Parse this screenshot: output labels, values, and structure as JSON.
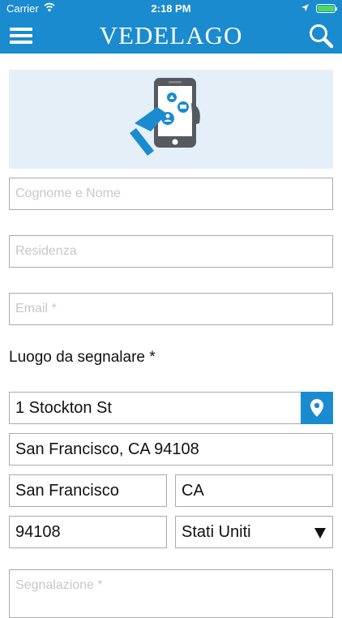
{
  "status_bar": {
    "carrier": "Carrier",
    "time": "2:18 PM"
  },
  "nav": {
    "title": "VEDELAGO",
    "menu_icon": "hamburger-menu-icon",
    "search_icon": "search-icon"
  },
  "banner": {
    "illustration": "phone-report-illustration"
  },
  "form": {
    "name_placeholder": "Cognome e Nome",
    "residence_placeholder": "Residenza",
    "email_placeholder": "Email *",
    "location_label": "Luogo da segnalare *",
    "street_value": "1 Stockton St",
    "full_address_value": "San Francisco, CA  94108",
    "city_value": "San Francisco",
    "state_value": "CA",
    "zip_value": "94108",
    "country_value": "Stati Uniti",
    "report_placeholder": "Segnalazione *"
  },
  "colors": {
    "accent": "#1b8bd0",
    "banner_bg": "#e4eff8"
  }
}
